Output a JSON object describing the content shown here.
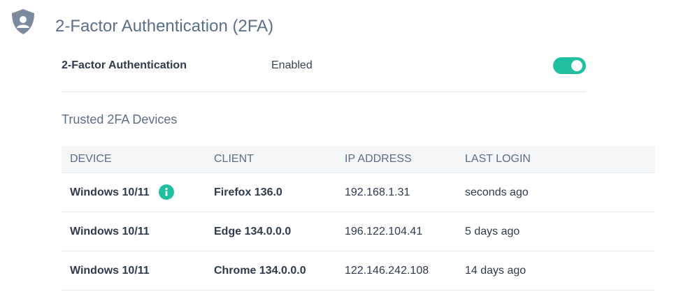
{
  "section": {
    "title": "2-Factor Authentication (2FA)",
    "icon": "shield-user-icon"
  },
  "setting": {
    "label": "2-Factor Authentication",
    "value": "Enabled",
    "toggle_on": true
  },
  "trusted_devices": {
    "title": "Trusted 2FA Devices",
    "columns": [
      "DEVICE",
      "CLIENT",
      "IP ADDRESS",
      "LAST LOGIN"
    ],
    "rows": [
      {
        "device": "Windows 10/11",
        "client": "Firefox 136.0",
        "ip": "192.168.1.31",
        "last_login": "seconds ago",
        "current": true
      },
      {
        "device": "Windows 10/11",
        "client": "Edge 134.0.0.0",
        "ip": "196.122.104.41",
        "last_login": "5 days ago",
        "current": false
      },
      {
        "device": "Windows 10/11",
        "client": "Chrome 134.0.0.0",
        "ip": "122.146.242.108",
        "last_login": "14 days ago",
        "current": false
      }
    ]
  },
  "colors": {
    "accent": "#20bf9f",
    "title": "#5a6f89",
    "icon": "#7c8a9e"
  }
}
